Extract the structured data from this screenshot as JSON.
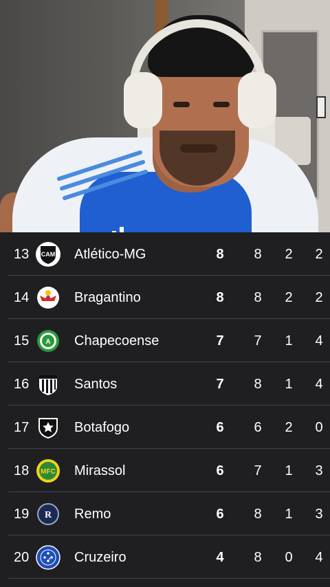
{
  "standings": {
    "rows": [
      {
        "pos": "13",
        "team": "Atlético-MG",
        "pts": "8",
        "c1": "8",
        "c2": "2",
        "c3": "2",
        "crest_color": "#ffffff",
        "crest_icon": "atletico-mg-crest-icon"
      },
      {
        "pos": "14",
        "team": "Bragantino",
        "pts": "8",
        "c1": "8",
        "c2": "2",
        "c3": "2",
        "crest_color": "#d9262c",
        "crest_icon": "bragantino-crest-icon"
      },
      {
        "pos": "15",
        "team": "Chapecoense",
        "pts": "7",
        "c1": "7",
        "c2": "1",
        "c3": "4",
        "crest_color": "#2a9a3a",
        "crest_icon": "chapecoense-crest-icon"
      },
      {
        "pos": "16",
        "team": "Santos",
        "pts": "7",
        "c1": "8",
        "c2": "1",
        "c3": "4",
        "crest_color": "#ffffff",
        "crest_icon": "santos-crest-icon"
      },
      {
        "pos": "17",
        "team": "Botafogo",
        "pts": "6",
        "c1": "6",
        "c2": "2",
        "c3": "0",
        "crest_color": "#111111",
        "crest_icon": "botafogo-crest-icon"
      },
      {
        "pos": "18",
        "team": "Mirassol",
        "pts": "6",
        "c1": "7",
        "c2": "1",
        "c3": "3",
        "crest_color": "#f2d21a",
        "crest_icon": "mirassol-crest-icon"
      },
      {
        "pos": "19",
        "team": "Remo",
        "pts": "6",
        "c1": "8",
        "c2": "1",
        "c3": "3",
        "crest_color": "#1b2a55",
        "crest_icon": "remo-crest-icon"
      },
      {
        "pos": "20",
        "team": "Cruzeiro",
        "pts": "4",
        "c1": "8",
        "c2": "0",
        "c3": "4",
        "crest_color": "#1d4fb8",
        "crest_icon": "cruzeiro-crest-icon"
      }
    ]
  },
  "colors": {
    "table_bg": "#1f1f21",
    "divider": "#45454a",
    "text": "#ffffff"
  }
}
